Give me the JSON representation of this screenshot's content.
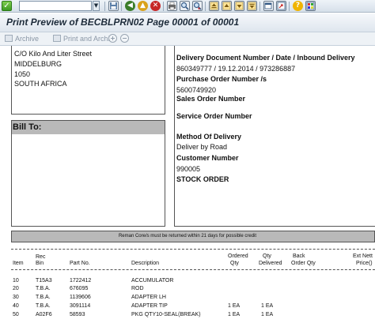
{
  "toolbar": {
    "enter_check": "✓",
    "command_value": "",
    "dropdown_arrow": "▼",
    "colors": {
      "accent": "#3d9a22",
      "back": "#3a7d2a",
      "exit": "#d9a21b",
      "cancel": "#c62828",
      "help": "#f0b400"
    }
  },
  "title": "Print Preview of BECBLPRN02 Page 00001 of 00001",
  "app_toolbar": {
    "archive": "Archive",
    "print_and_archive": "Print and Archive",
    "zoom_in": "+",
    "zoom_out": "−"
  },
  "ship_from": {
    "lines": [
      "C/O Kilo And Liter Street",
      "MIDDELBURG",
      "1050",
      "SOUTH AFRICA"
    ]
  },
  "bill_to": {
    "label": "Bill To:"
  },
  "delivery_info": {
    "doc_label": "Delivery Document Number / Date / Inbound Delivery",
    "doc_value": "860349777 / 19.12.2014 / 973286887",
    "po_label": "Purchase Order Number /s",
    "po_value": "5600749920",
    "so_label": "Sales Order Number",
    "service_label": "Service Order Number",
    "method_label": "Method Of Delivery",
    "method_value": "Deliver by Road",
    "customer_label": "Customer Number",
    "customer_value": "990005",
    "stock_label": "STOCK ORDER"
  },
  "notice": "Reman Core/s must be returned within 21 days for possible credit",
  "table": {
    "headers": {
      "rec_top": "Rec",
      "item": "Item",
      "bin": "Bin",
      "part_no": "Part No.",
      "description": "Description",
      "ordered_top": "Ordered",
      "ordered_bottom": "Qty",
      "qty_top": "Qty",
      "qty_bottom": "Delivered",
      "back_top": "Back",
      "back_bottom": "Order Qty",
      "ext_top": "Ext Nett",
      "ext_bottom": "Price()"
    },
    "rows": [
      {
        "item": "10",
        "bin": "T15A3",
        "part": "1722412",
        "desc": "ACCUMULATOR",
        "ordered": "",
        "delivered": ""
      },
      {
        "item": "20",
        "bin": "T.B.A.",
        "part": "676095",
        "desc": "ROD",
        "ordered": "",
        "delivered": ""
      },
      {
        "item": "30",
        "bin": "T.B.A.",
        "part": "1139606",
        "desc": "ADAPTER LH",
        "ordered": "",
        "delivered": ""
      },
      {
        "item": "40",
        "bin": "T.B.A.",
        "part": "3091114",
        "desc": "ADAPTER TIP",
        "ordered": "1  EA",
        "delivered": "1 EA"
      },
      {
        "item": "50",
        "bin": "A02F6",
        "part": "58593",
        "desc": "PKG QTY10-SEAL(BREAK)",
        "ordered": "1  EA",
        "delivered": "1 EA"
      }
    ]
  }
}
